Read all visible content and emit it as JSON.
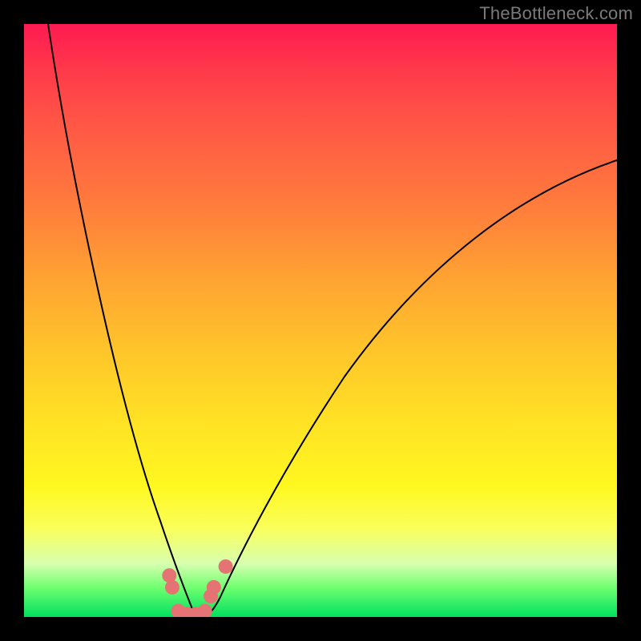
{
  "watermark": {
    "text": "TheBottleneck.com"
  },
  "chart_data": {
    "type": "line",
    "title": "",
    "xlabel": "",
    "ylabel": "",
    "xlim": [
      0,
      100
    ],
    "ylim": [
      0,
      100
    ],
    "grid": false,
    "legend": false,
    "series": [
      {
        "name": "bottleneck-curve-left",
        "x": [
          4,
          6,
          8,
          10,
          12,
          14,
          16,
          18,
          20,
          22,
          24,
          25.5,
          27,
          28
        ],
        "y": [
          100,
          86,
          73,
          61,
          50,
          40,
          31,
          23,
          16,
          10,
          5,
          2,
          0.5,
          0
        ]
      },
      {
        "name": "bottleneck-curve-right",
        "x": [
          28,
          30,
          33,
          36,
          40,
          45,
          50,
          56,
          63,
          71,
          80,
          90,
          100
        ],
        "y": [
          0,
          2,
          6,
          12,
          20,
          29,
          37,
          45,
          53,
          60,
          67,
          73,
          78
        ]
      }
    ],
    "markers": [
      {
        "name": "dot-left-upper",
        "x": 24.5,
        "y": 7.0
      },
      {
        "name": "dot-left-lower",
        "x": 25.0,
        "y": 5.0
      },
      {
        "name": "dot-bottom-1",
        "x": 26.0,
        "y": 1.0
      },
      {
        "name": "dot-bottom-2",
        "x": 27.5,
        "y": 0.5
      },
      {
        "name": "dot-bottom-3",
        "x": 29.0,
        "y": 0.5
      },
      {
        "name": "dot-bottom-4",
        "x": 30.5,
        "y": 1.0
      },
      {
        "name": "dot-right-lower",
        "x": 31.5,
        "y": 3.5
      },
      {
        "name": "dot-right-mid",
        "x": 32.0,
        "y": 5.0
      },
      {
        "name": "dot-right-upper",
        "x": 34.0,
        "y": 8.5
      }
    ],
    "background_gradient": {
      "top": "#ff1a52",
      "mid": "#ffe424",
      "bottom": "#00e060"
    }
  }
}
